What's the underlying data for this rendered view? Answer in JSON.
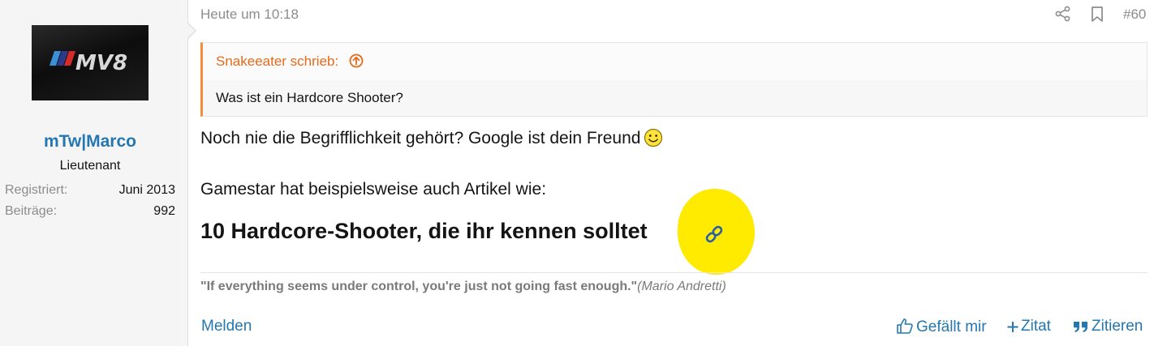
{
  "user": {
    "avatar_text": "MV8",
    "username": "mTw|Marco",
    "title": "Lieutenant",
    "stats": [
      {
        "label": "Registriert:",
        "value": "Juni 2013"
      },
      {
        "label": "Beiträge:",
        "value": "992"
      }
    ]
  },
  "post": {
    "date": "Heute um 10:18",
    "number": "#60",
    "icons": [
      "share-icon",
      "bookmark-icon"
    ]
  },
  "quote": {
    "author": "Snakeeater schrieb:",
    "text": "Was ist ein Hardcore Shooter?"
  },
  "body": {
    "line1": "Noch nie die Begrifflichkeit gehört? Google ist dein Freund",
    "line2": "Gamestar hat beispielsweise auch Artikel wie:",
    "headline": "10 Hardcore-Shooter, die ihr kennen solltet"
  },
  "signature": {
    "quote": "\"If everything seems under control, you're just not going fast enough.\"",
    "author": "(Mario Andretti)"
  },
  "footer": {
    "report": "Melden",
    "like": "Gefällt mir",
    "plus_quote": "Zitat",
    "reply": "Zitieren"
  },
  "colors": {
    "link": "#2577b1",
    "quote_accent": "#f78c3a",
    "highlight": "#ffeb00"
  }
}
